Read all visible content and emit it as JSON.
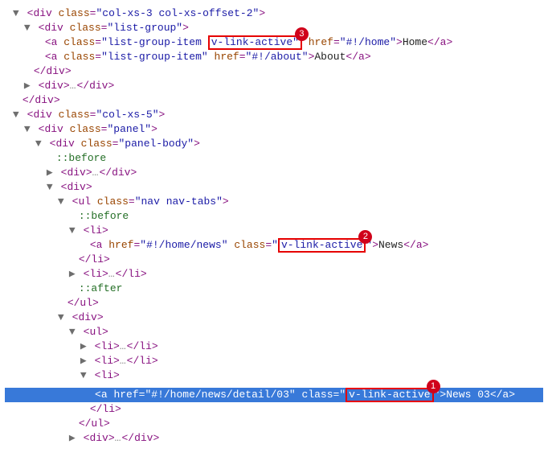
{
  "glyph": {
    "open": "▼",
    "closed": "▶"
  },
  "lt": "<",
  "gt": ">",
  "sl": "</",
  "eq": "=",
  "t": {
    "div": "div",
    "a": "a",
    "ul": "ul",
    "li": "li"
  },
  "attr": {
    "class": "class",
    "href": "href"
  },
  "pseudo": {
    "before": "::before",
    "after": "::after"
  },
  "ell": "…",
  "c": {
    "col_xs_3": "\"col-xs-3 col-xs-offset-2\"",
    "list_group": "\"list-group\"",
    "list_group_item": "\"list-group-item",
    "v_link_active": "v-link-active",
    "v_link_active_q": "v-link-active\"",
    "home_href": "\"#!/home\"",
    "about_href": "\"#!/about\"",
    "col_xs_5": "\"col-xs-5\"",
    "panel": "\"panel\"",
    "panel_body": "\"panel-body\"",
    "nav_tabs": "\"nav nav-tabs\"",
    "news_href": "\"#!/home/news\"",
    "detail_href": "\"#!/home/news/detail/03\"",
    "qo": "\"",
    "qc": "\""
  },
  "text": {
    "home": "Home",
    "about": "About",
    "news": "News",
    "news03": "News 03"
  },
  "badge": {
    "b1": "1",
    "b2": "2",
    "b3": "3"
  }
}
